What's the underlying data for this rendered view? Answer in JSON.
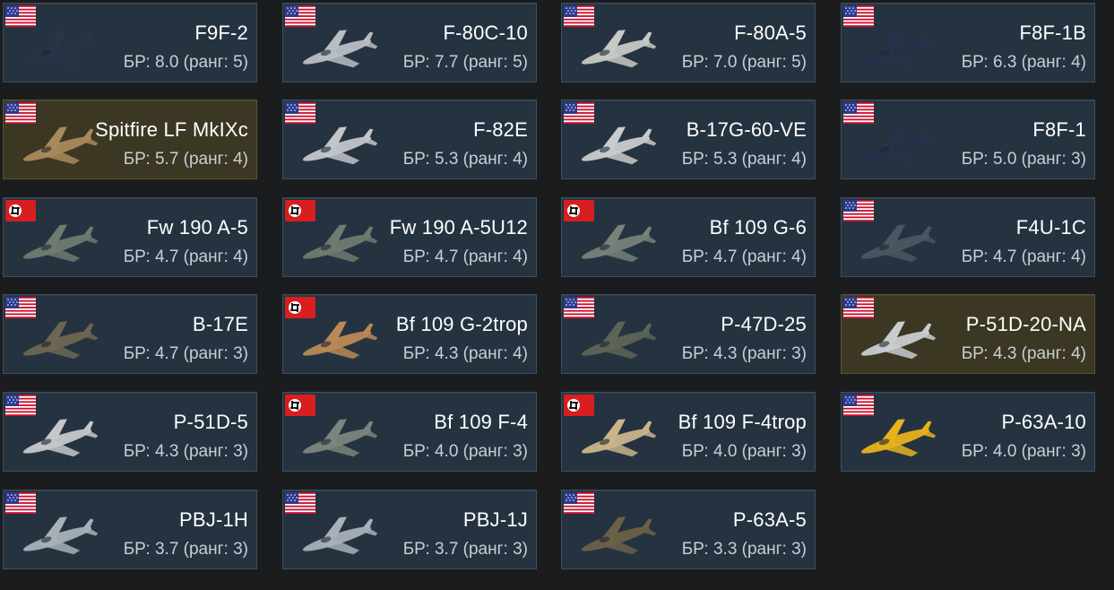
{
  "vehicles": [
    {
      "name": "F9F-2",
      "br": "БР: 8.0 (ранг: 5)",
      "nation": "usa",
      "premium": false,
      "camo": "#2a3447"
    },
    {
      "name": "F-80C-10",
      "br": "БР: 7.7 (ранг: 5)",
      "nation": "usa",
      "premium": false,
      "camo": "#b9bec4"
    },
    {
      "name": "F-80A-5",
      "br": "БР: 7.0 (ранг: 5)",
      "nation": "usa",
      "premium": false,
      "camo": "#c7c9c6"
    },
    {
      "name": "F8F-1B",
      "br": "БР: 6.3 (ранг: 4)",
      "nation": "usa",
      "premium": false,
      "camo": "#26324a"
    },
    {
      "name": "Spitfire LF MkIXc",
      "br": "БР: 5.7 (ранг: 4)",
      "nation": "usa",
      "premium": true,
      "camo": "#a98a5a"
    },
    {
      "name": "F-82E",
      "br": "БР: 5.3 (ранг: 4)",
      "nation": "usa",
      "premium": false,
      "camo": "#c2c6ca"
    },
    {
      "name": "B-17G-60-VE",
      "br": "БР: 5.3 (ранг: 4)",
      "nation": "usa",
      "premium": false,
      "camo": "#c9cbcc"
    },
    {
      "name": "F8F-1",
      "br": "БР: 5.0 (ранг: 3)",
      "nation": "usa",
      "premium": false,
      "camo": "#26324a"
    },
    {
      "name": "Fw 190 A-5",
      "br": "БР: 4.7 (ранг: 4)",
      "nation": "germany",
      "premium": false,
      "camo": "#6f7a70"
    },
    {
      "name": "Fw 190 A-5U12",
      "br": "БР: 4.7 (ранг: 4)",
      "nation": "germany",
      "premium": false,
      "camo": "#6f7a70"
    },
    {
      "name": "Bf 109 G-6",
      "br": "БР: 4.7 (ранг: 4)",
      "nation": "germany",
      "premium": false,
      "camo": "#77817a"
    },
    {
      "name": "F4U-1C",
      "br": "БР: 4.7 (ранг: 4)",
      "nation": "usa",
      "premium": false,
      "camo": "#4c5663"
    },
    {
      "name": "B-17E",
      "br": "БР: 4.7 (ранг: 3)",
      "nation": "usa",
      "premium": false,
      "camo": "#6d6653"
    },
    {
      "name": "Bf 109 G-2trop",
      "br": "БР: 4.3 (ранг: 4)",
      "nation": "germany",
      "premium": false,
      "camo": "#b98a55"
    },
    {
      "name": "P-47D-25",
      "br": "БР: 4.3 (ранг: 3)",
      "nation": "usa",
      "premium": false,
      "camo": "#5d6457"
    },
    {
      "name": "P-51D-20-NA",
      "br": "БР: 4.3 (ранг: 4)",
      "nation": "usa",
      "premium": true,
      "camo": "#c9cccf"
    },
    {
      "name": "P-51D-5",
      "br": "БР: 4.3 (ранг: 3)",
      "nation": "usa",
      "premium": false,
      "camo": "#c5c8cb"
    },
    {
      "name": "Bf 109 F-4",
      "br": "БР: 4.0 (ранг: 3)",
      "nation": "germany",
      "premium": false,
      "camo": "#7b857d"
    },
    {
      "name": "Bf 109 F-4trop",
      "br": "БР: 4.0 (ранг: 3)",
      "nation": "germany",
      "premium": false,
      "camo": "#c9b48c"
    },
    {
      "name": "P-63A-10",
      "br": "БР: 4.0 (ранг: 3)",
      "nation": "usa",
      "premium": false,
      "camo": "#e7b21c"
    },
    {
      "name": "PBJ-1H",
      "br": "БР: 3.7 (ранг: 3)",
      "nation": "usa",
      "premium": false,
      "camo": "#a8b0b8"
    },
    {
      "name": "PBJ-1J",
      "br": "БР: 3.7 (ранг: 3)",
      "nation": "usa",
      "premium": false,
      "camo": "#a8b0b8"
    },
    {
      "name": "P-63A-5",
      "br": "БР: 3.3 (ранг: 3)",
      "nation": "usa",
      "premium": false,
      "camo": "#6b6148"
    }
  ],
  "colors": {
    "card_bg": "#253341",
    "card_premium_bg": "#3b3723",
    "page_bg": "#1b1c1d"
  }
}
